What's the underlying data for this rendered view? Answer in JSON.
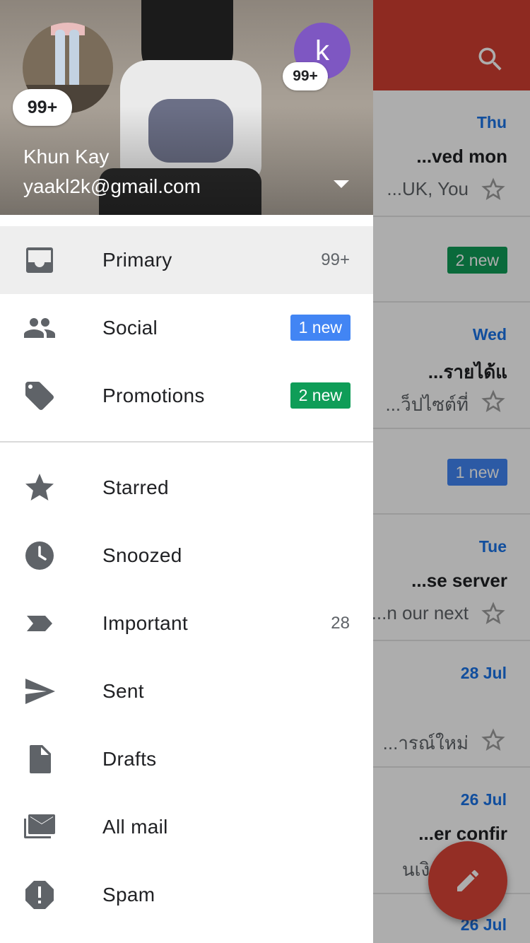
{
  "colors": {
    "app_bar": "#d23f31",
    "chip_blue": "#4285f4",
    "chip_green": "#0f9d58",
    "avatar_alt": "#7e57c2",
    "fab": "#db4437"
  },
  "account": {
    "name": "Khun Kay",
    "email": "yaakl2k@gmail.com",
    "main_badge": "99+",
    "alt_avatar_letter": "k",
    "alt_badge": "99+"
  },
  "drawer": {
    "primary": {
      "label": "Primary",
      "count": "99+",
      "icon": "inbox-icon"
    },
    "social": {
      "label": "Social",
      "chip": "1 new",
      "icon": "people-icon"
    },
    "promotions": {
      "label": "Promotions",
      "chip": "2 new",
      "icon": "tag-icon"
    },
    "starred": {
      "label": "Starred",
      "icon": "star-icon"
    },
    "snoozed": {
      "label": "Snoozed",
      "icon": "clock-icon"
    },
    "important": {
      "label": "Important",
      "count": "28",
      "icon": "important-marker-icon"
    },
    "sent": {
      "label": "Sent",
      "icon": "send-icon"
    },
    "drafts": {
      "label": "Drafts",
      "icon": "draft-icon"
    },
    "all_mail": {
      "label": "All mail",
      "icon": "all-mail-icon"
    },
    "spam": {
      "label": "Spam",
      "icon": "spam-icon"
    }
  },
  "background_inbox": {
    "rows": [
      {
        "date": "Thu",
        "subject": "ved mon...",
        "snippet": "UK, You..."
      },
      {
        "chip": "2 new"
      },
      {
        "date": "Wed",
        "subject": "รายได้แ...",
        "snippet": "ว็ปไซต์ที่..."
      },
      {
        "chip": "1 new"
      },
      {
        "date": "Tue",
        "subject": "se server...",
        "snippet": "n our next..."
      },
      {
        "date": "28 Jul",
        "subject": "",
        "snippet": "ารณ์ใหม่..."
      },
      {
        "date": "26 Jul",
        "subject": "er confir...",
        "snippet": "นเงิน ผ่า"
      },
      {
        "date": "26 Jul"
      }
    ]
  }
}
